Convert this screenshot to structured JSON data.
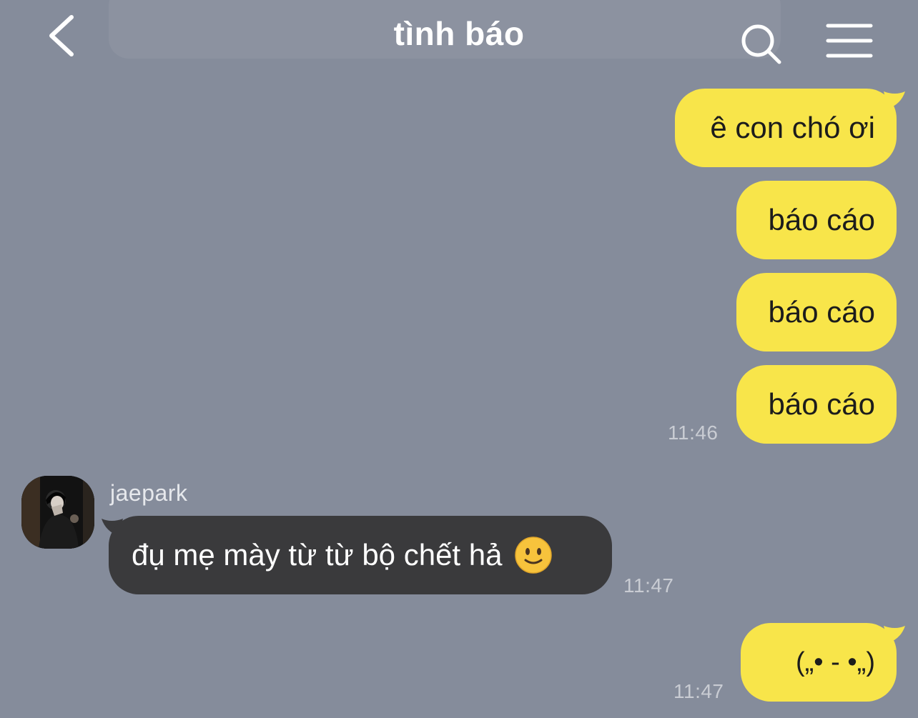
{
  "header": {
    "title": "tình báo",
    "back_icon": "chevron-left-icon",
    "search_icon": "search-icon",
    "menu_icon": "hamburger-menu-icon"
  },
  "colors": {
    "background": "#858c9b",
    "outgoing_bubble": "#f8e54a",
    "incoming_bubble": "#3a3a3c",
    "timestamp": "#c9ccd3"
  },
  "messages": [
    {
      "direction": "out",
      "text": "ê con chó ơi"
    },
    {
      "direction": "out",
      "text": "báo cáo"
    },
    {
      "direction": "out",
      "text": "báo cáo"
    },
    {
      "direction": "out",
      "text": "báo cáo",
      "time": "11:46"
    },
    {
      "direction": "in",
      "sender": "jaepark",
      "text": "đụ mẹ mày từ từ bộ chết hả",
      "emoji": "slightly-smiling-face-icon",
      "time": "11:47"
    },
    {
      "direction": "out",
      "text": "(„• - •„)",
      "time": "11:47"
    }
  ]
}
